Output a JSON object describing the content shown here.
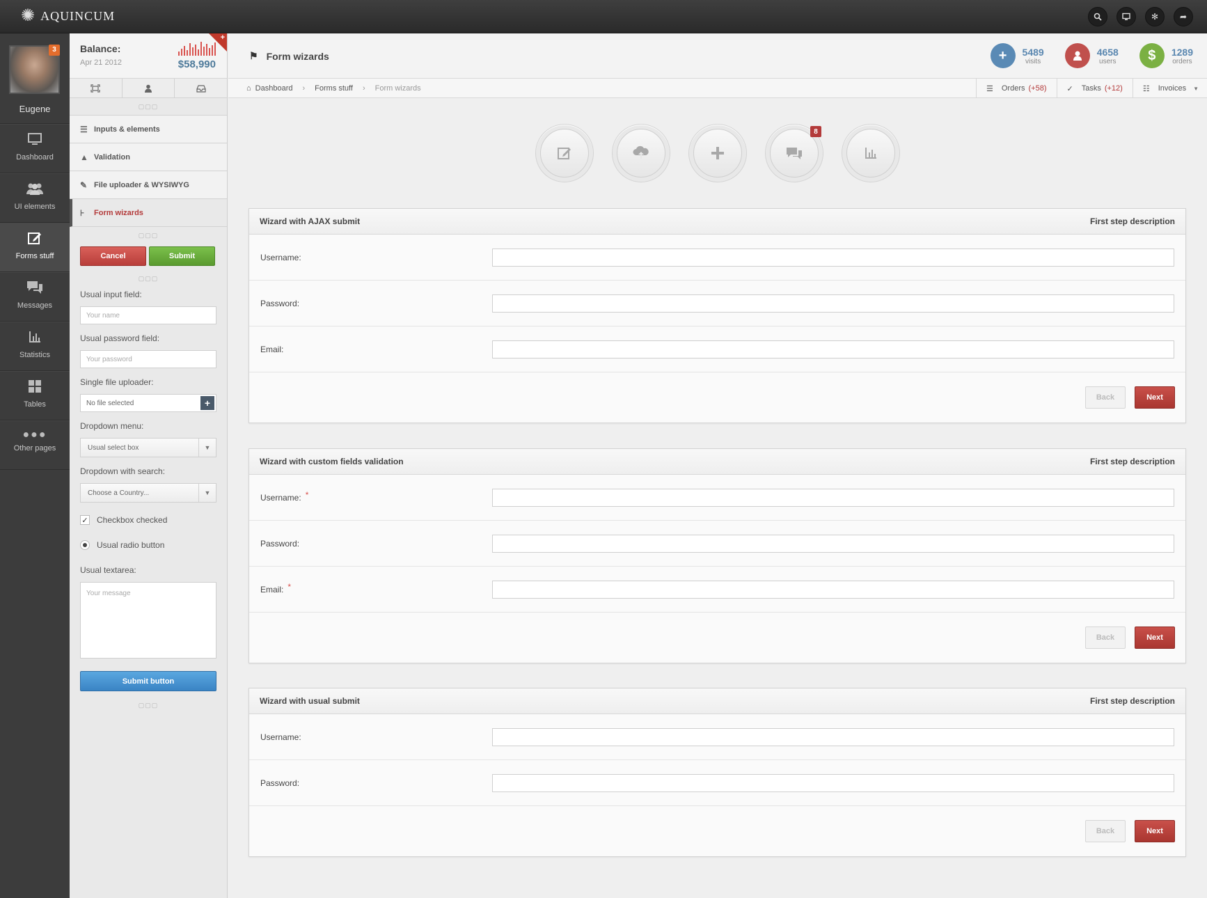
{
  "app": {
    "name": "AQUINCUM"
  },
  "topbar": {
    "icons": [
      "search-icon",
      "monitor-icon",
      "gear-icon",
      "share-icon"
    ]
  },
  "user": {
    "name": "Eugene",
    "badge": "3"
  },
  "nav": [
    {
      "label": "Dashboard",
      "icon": "monitor-icon",
      "active": false
    },
    {
      "label": "UI elements",
      "icon": "users-icon",
      "active": false
    },
    {
      "label": "Forms stuff",
      "icon": "edit-icon",
      "active": true
    },
    {
      "label": "Messages",
      "icon": "messages-icon",
      "active": false
    },
    {
      "label": "Statistics",
      "icon": "chart-icon",
      "active": false
    },
    {
      "label": "Tables",
      "icon": "table-icon",
      "active": false
    },
    {
      "label": "Other pages",
      "icon": "more-icon",
      "active": false
    }
  ],
  "balance": {
    "title": "Balance:",
    "date": "Apr 21 2012",
    "amount": "$58,990",
    "corner": "+"
  },
  "sidetabs": [
    "fullscreen-icon",
    "user-icon",
    "inbox-icon"
  ],
  "submenu": [
    {
      "label": "Inputs & elements",
      "icon": "list-icon",
      "active": false
    },
    {
      "label": "Validation",
      "icon": "warning-icon",
      "active": false
    },
    {
      "label": "File uploader & WYSIWYG",
      "icon": "pencil-icon",
      "active": false
    },
    {
      "label": "Form wizards",
      "icon": "wizard-icon",
      "active": true
    }
  ],
  "sideform": {
    "cancel": "Cancel",
    "submit": "Submit",
    "input_label": "Usual input field:",
    "input_placeholder": "Your name",
    "password_label": "Usual password field:",
    "password_placeholder": "Your password",
    "file_label": "Single file uploader:",
    "file_value": "No file selected",
    "file_plus": "+",
    "dropdown_label": "Dropdown menu:",
    "dropdown_value": "Usual select box",
    "search_label": "Dropdown with search:",
    "search_value": "Choose a Country...",
    "checkbox_label": "Checkbox checked",
    "radio_label": "Usual radio button",
    "textarea_label": "Usual textarea:",
    "textarea_placeholder": "Your message",
    "submit_button": "Submit button"
  },
  "page": {
    "title": "Form wizards"
  },
  "stats": [
    {
      "value": "5489",
      "label": "visits",
      "color": "#5a8ab5",
      "symbol": "+"
    },
    {
      "value": "4658",
      "label": "users",
      "color": "#c0504d",
      "symbol": "👤"
    },
    {
      "value": "1289",
      "label": "orders",
      "color": "#7bb043",
      "symbol": "$"
    }
  ],
  "breadcrumbs": [
    "Dashboard",
    "Forms stuff",
    "Form wizards"
  ],
  "actions": [
    {
      "label": "Orders",
      "count": "(+58)"
    },
    {
      "label": "Tasks",
      "count": "(+12)"
    },
    {
      "label": "Invoices",
      "count": ""
    }
  ],
  "circle_buttons": [
    {
      "icon": "edit-icon",
      "badge": ""
    },
    {
      "icon": "cloud-upload-icon",
      "badge": ""
    },
    {
      "icon": "plus-icon",
      "badge": ""
    },
    {
      "icon": "messages-icon",
      "badge": "8"
    },
    {
      "icon": "chart-icon",
      "badge": ""
    }
  ],
  "wizards": [
    {
      "title": "Wizard with AJAX submit",
      "step": "First step description",
      "fields": [
        {
          "label": "Username:",
          "required": false
        },
        {
          "label": "Password:",
          "required": false
        },
        {
          "label": "Email:",
          "required": false
        }
      ],
      "back": "Back",
      "next": "Next"
    },
    {
      "title": "Wizard with custom fields validation",
      "step": "First step description",
      "fields": [
        {
          "label": "Username:",
          "required": true
        },
        {
          "label": "Password:",
          "required": false
        },
        {
          "label": "Email:",
          "required": true
        }
      ],
      "back": "Back",
      "next": "Next"
    },
    {
      "title": "Wizard with usual submit",
      "step": "First step description",
      "fields": [
        {
          "label": "Username:",
          "required": false
        },
        {
          "label": "Password:",
          "required": false
        }
      ],
      "back": "Back",
      "next": "Next"
    }
  ],
  "required_mark": "*"
}
